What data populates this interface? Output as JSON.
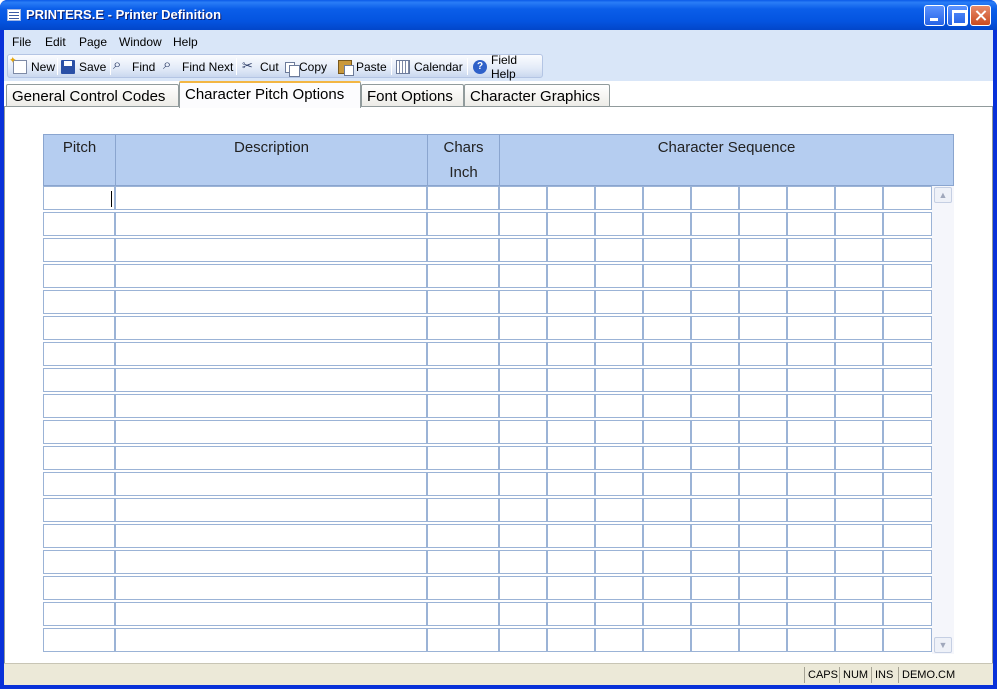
{
  "window": {
    "title": "PRINTERS.E - Printer Definition"
  },
  "menu": [
    "File",
    "Edit",
    "Page",
    "Window",
    "Help"
  ],
  "toolbar": {
    "new": "New",
    "save": "Save",
    "find": "Find",
    "find_next": "Find Next",
    "cut": "Cut",
    "copy": "Copy",
    "paste": "Paste",
    "calendar": "Calendar",
    "field_help": "Field Help"
  },
  "icons": {
    "new": "new-document-icon",
    "save": "floppy-disk-icon",
    "find": "binoculars-icon",
    "find_next": "binoculars-next-icon",
    "cut": "scissors-icon",
    "copy": "copy-icon",
    "paste": "clipboard-icon",
    "calendar": "calendar-icon",
    "help": "question-mark-icon"
  },
  "tabs": [
    "General Control Codes",
    "Character Pitch Options",
    "Font Options",
    "Character Graphics"
  ],
  "active_tab": "Character Pitch Options",
  "grid": {
    "headers": {
      "pitch": "Pitch",
      "description": "Description",
      "chars_line1": "Chars",
      "chars_line2": "Inch",
      "sequence": "Character Sequence"
    },
    "row_count": 18,
    "sequence_columns": 9,
    "rows": []
  },
  "status": {
    "caps": "CAPS",
    "num": "NUM",
    "ins": "INS",
    "account": "DEMO.CM"
  },
  "colors": {
    "title_bar": "#0454e0",
    "menu_bg": "#d9e6f8",
    "grid_header": "#b5cdf0",
    "active_tab_highlight": "#f3b643"
  }
}
